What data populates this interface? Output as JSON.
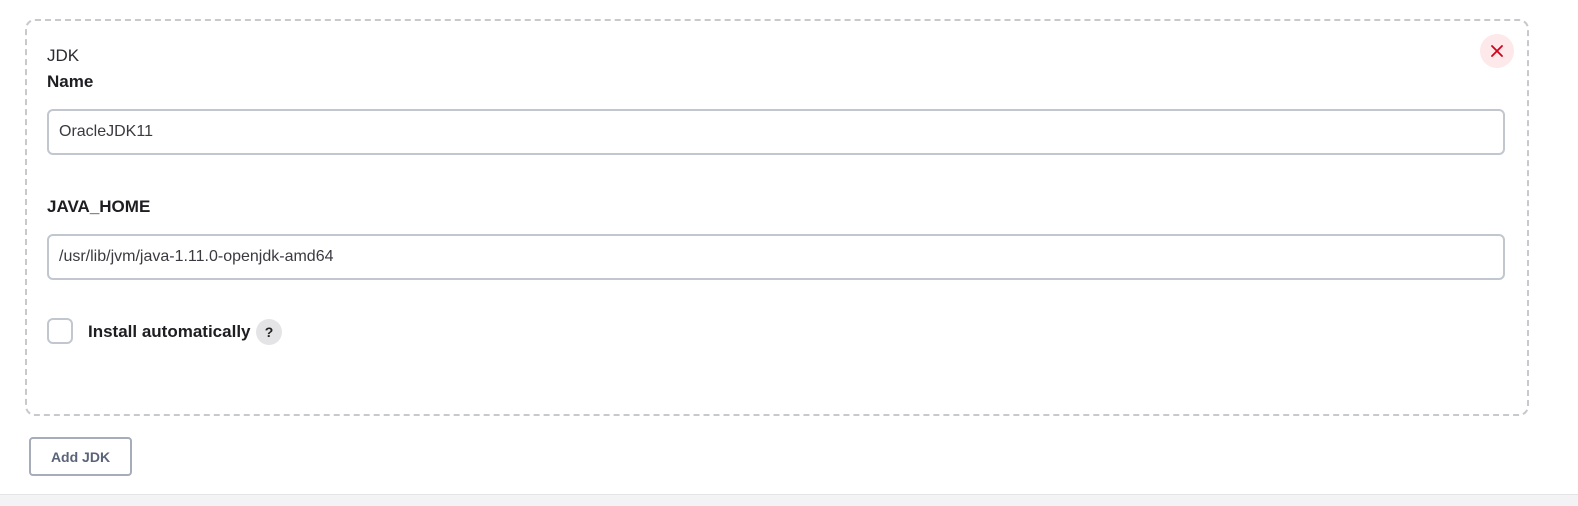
{
  "jdk_card": {
    "title": "JDK",
    "name_label": "Name",
    "name_value": "OracleJDK11",
    "java_home_label": "JAVA_HOME",
    "java_home_value": "/usr/lib/jvm/java-1.11.0-openjdk-amd64",
    "install_automatically_label": "Install automatically",
    "install_automatically_checked": false,
    "help_glyph": "?",
    "close_icon": "close-icon"
  },
  "add_jdk_button": {
    "label": "Add JDK"
  },
  "colors": {
    "close_icon": "#d0021b",
    "close_background": "#fde8ea",
    "border_dashed": "#c8c9cc",
    "button_text": "#5a6379"
  }
}
